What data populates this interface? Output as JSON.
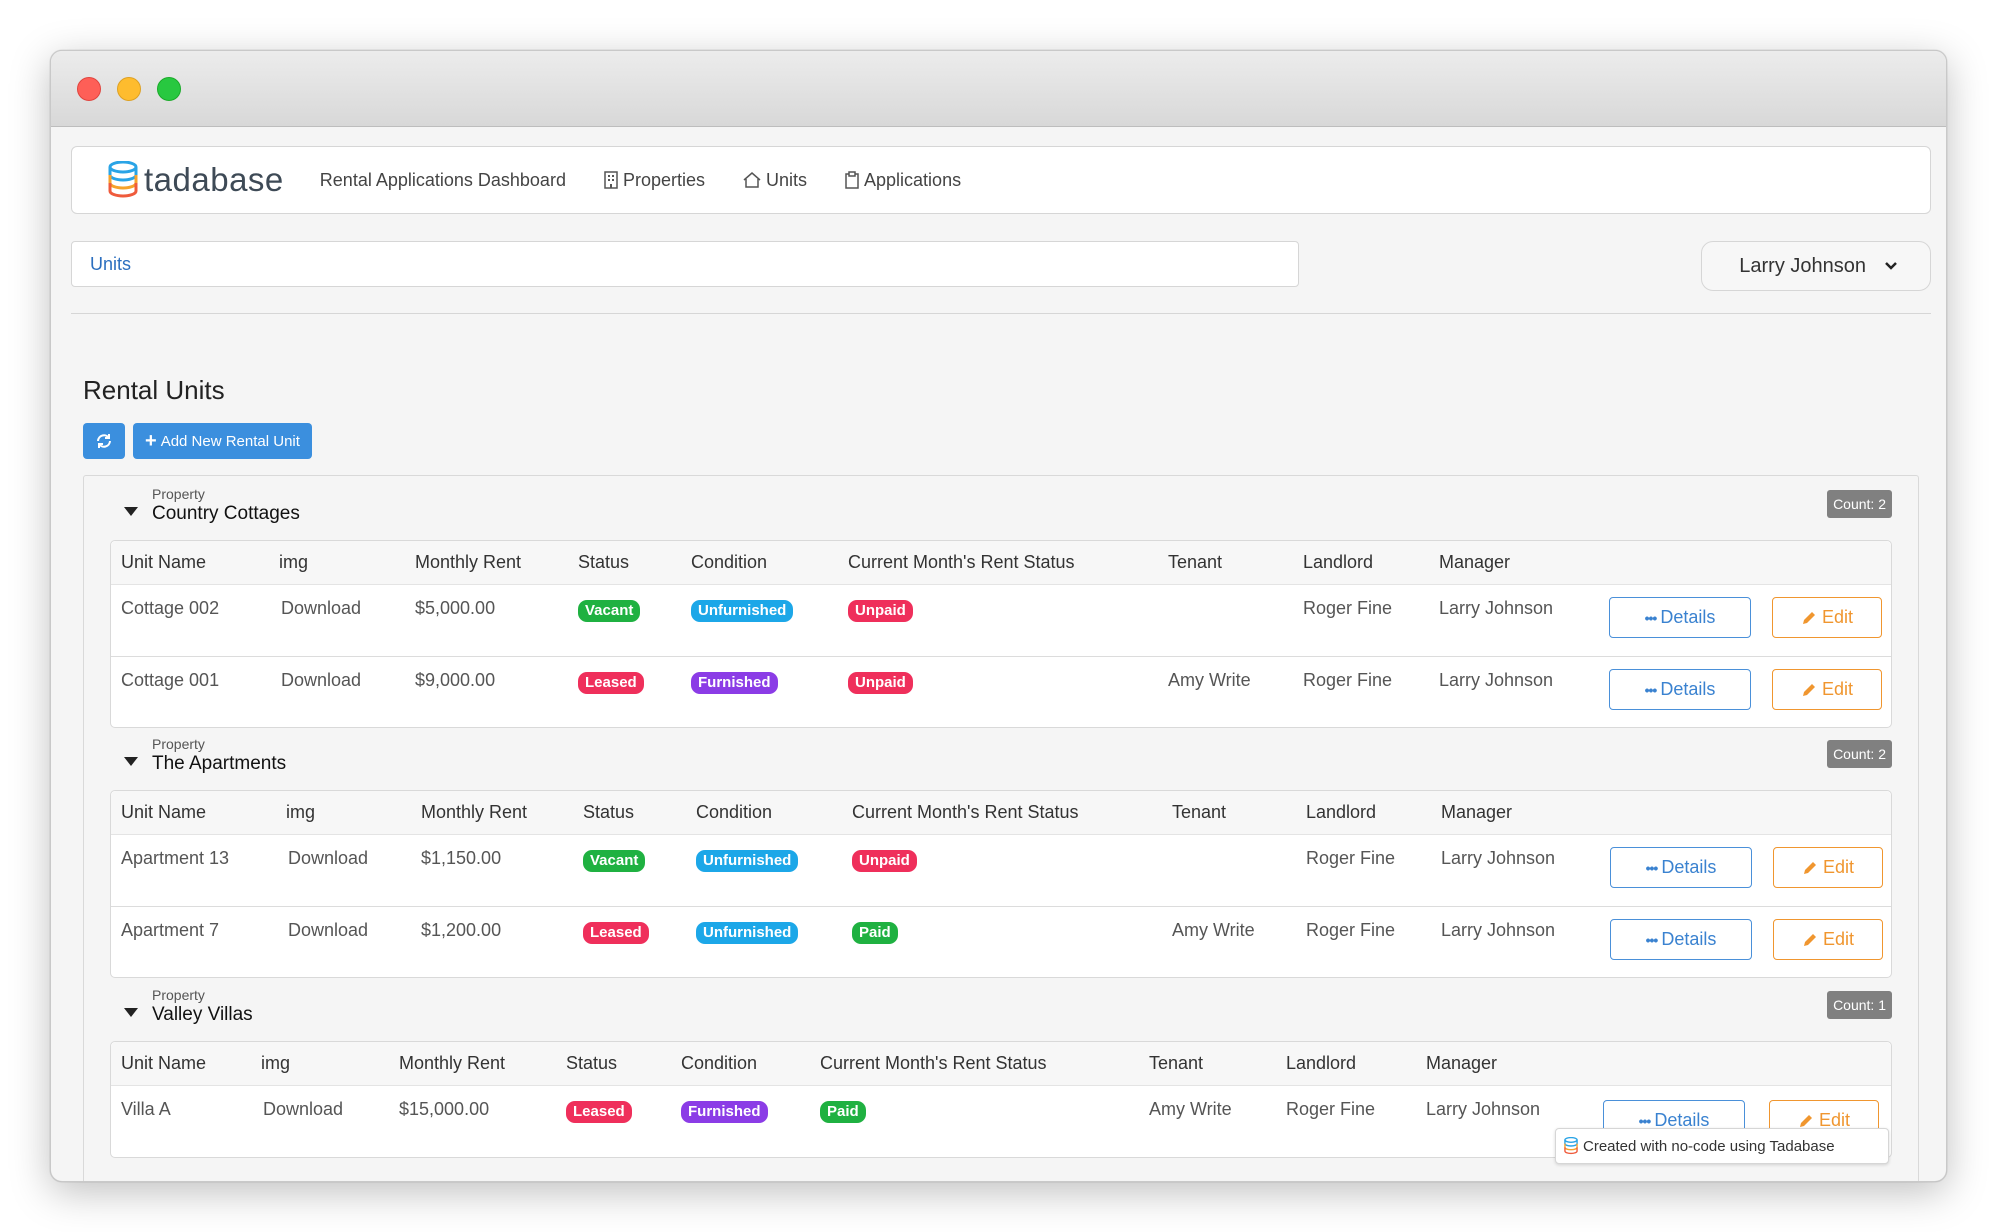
{
  "window": {
    "title": ""
  },
  "brand": {
    "name": "tadabase"
  },
  "nav": {
    "items": [
      {
        "label": "Rental Applications Dashboard",
        "icon": "none"
      },
      {
        "label": "Properties",
        "icon": "building-icon"
      },
      {
        "label": "Units",
        "icon": "home-icon"
      },
      {
        "label": "Applications",
        "icon": "clipboard-icon"
      }
    ]
  },
  "breadcrumb": {
    "label": "Units"
  },
  "user": {
    "name": "Larry Johnson"
  },
  "page": {
    "title": "Rental Units",
    "add_label": "Add New Rental Unit"
  },
  "columns": [
    "Unit Name",
    "img",
    "Monthly Rent",
    "Status",
    "Condition",
    "Current Month's Rent Status",
    "Tenant",
    "Landlord",
    "Manager"
  ],
  "groups": [
    {
      "label": "Property",
      "name": "Country Cottages",
      "count": "Count: 2",
      "rows": [
        {
          "unit": "Cottage 002",
          "img": "Download",
          "rent": "$5,000.00",
          "status": "Vacant",
          "condition": "Unfurnished",
          "rent_status": "Unpaid",
          "tenant": "",
          "landlord": "Roger Fine",
          "manager": "Larry Johnson"
        },
        {
          "unit": "Cottage 001",
          "img": "Download",
          "rent": "$9,000.00",
          "status": "Leased",
          "condition": "Furnished",
          "rent_status": "Unpaid",
          "tenant": "Amy Write",
          "landlord": "Roger Fine",
          "manager": "Larry Johnson"
        }
      ]
    },
    {
      "label": "Property",
      "name": "The Apartments",
      "count": "Count: 2",
      "rows": [
        {
          "unit": "Apartment 13",
          "img": "Download",
          "rent": "$1,150.00",
          "status": "Vacant",
          "condition": "Unfurnished",
          "rent_status": "Unpaid",
          "tenant": "",
          "landlord": "Roger Fine",
          "manager": "Larry Johnson"
        },
        {
          "unit": "Apartment 7",
          "img": "Download",
          "rent": "$1,200.00",
          "status": "Leased",
          "condition": "Unfurnished",
          "rent_status": "Paid",
          "tenant": "Amy Write",
          "landlord": "Roger Fine",
          "manager": "Larry Johnson"
        }
      ]
    },
    {
      "label": "Property",
      "name": "Valley Villas",
      "count": "Count: 1",
      "rows": [
        {
          "unit": "Villa A",
          "img": "Download",
          "rent": "$15,000.00",
          "status": "Leased",
          "condition": "Furnished",
          "rent_status": "Paid",
          "tenant": "Amy Write",
          "landlord": "Roger Fine",
          "manager": "Larry Johnson"
        }
      ]
    }
  ],
  "actions": {
    "details_label": "Details",
    "edit_label": "Edit"
  },
  "footer": {
    "credit": "Created with no-code using Tadabase"
  },
  "colors": {
    "primary": "#3b8fde",
    "vacant": "#1fb141",
    "leased": "#ef2f5b",
    "unfurnished": "#1ca7e8",
    "furnished": "#8b3ce6",
    "paid": "#1fb141",
    "unpaid": "#ef2f5b",
    "edit": "#f0962f"
  }
}
